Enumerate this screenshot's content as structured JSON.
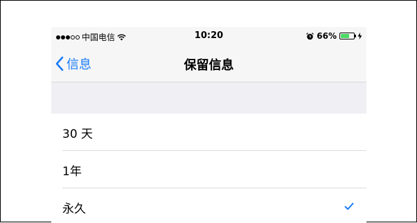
{
  "status_bar": {
    "carrier": "中国电信",
    "time": "10:20",
    "battery_percent": "66%",
    "battery_level": 0.66,
    "signal_bars_filled": 3,
    "signal_bars_total": 5,
    "icons": [
      "wifi-icon",
      "alarm-icon",
      "battery-icon",
      "charging-bolt-icon"
    ]
  },
  "nav": {
    "back_label": "信息",
    "title": "保留信息"
  },
  "options": [
    {
      "label": "30 天",
      "selected": false
    },
    {
      "label": "1年",
      "selected": false
    },
    {
      "label": "永久",
      "selected": true
    }
  ],
  "colors": {
    "accent": "#1a7cf5",
    "bar_background": "#f6f6f7",
    "group_background": "#efeff4",
    "battery_fill": "#4cd964"
  }
}
